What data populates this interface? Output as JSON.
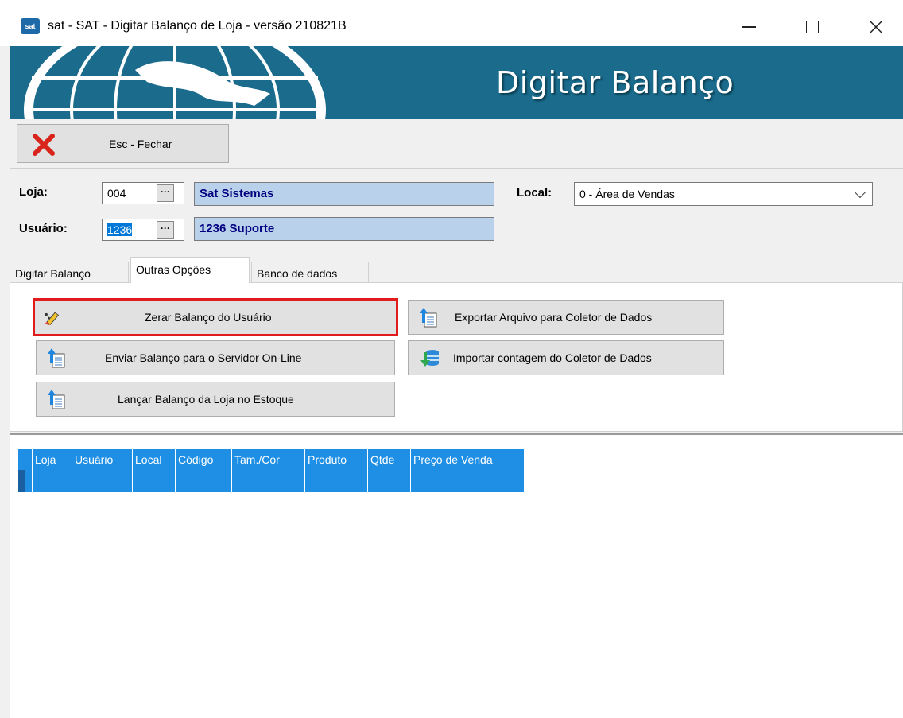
{
  "window": {
    "title": "sat - SAT - Digitar Balanço de Loja - versão 210821B",
    "icon_label": "sat"
  },
  "banner": {
    "title": "Digitar Balanço"
  },
  "toolbar": {
    "close_label": "Esc - Fechar"
  },
  "form": {
    "loja_label": "Loja:",
    "loja_code": "004",
    "loja_name": "Sat Sistemas",
    "usuario_label": "Usuário:",
    "usuario_code": "1236",
    "usuario_name": "1236 Suporte",
    "local_label": "Local:",
    "local_value": "0 - Área de Vendas",
    "dots": "···"
  },
  "tabs": [
    {
      "label": "Digitar Balanço",
      "active": false
    },
    {
      "label": "Outras Opções",
      "active": true
    },
    {
      "label": "Banco de dados",
      "active": false
    }
  ],
  "actions": {
    "zerar": "Zerar Balanço do Usuário",
    "enviar": "Enviar Balanço para o Servidor On-Line",
    "lancar": "Lançar Balanço da Loja no Estoque",
    "exportar": "Exportar Arquivo para Coletor de Dados",
    "importar": "Importar contagem do Coletor de Dados"
  },
  "grid": {
    "columns": [
      "Loja",
      "Usuário",
      "Local",
      "Código",
      "Tam./Cor",
      "Produto",
      "Qtde",
      "Preço de Venda"
    ]
  },
  "colors": {
    "banner": "#1a6b8c",
    "grid_selection": "#1e8fe4",
    "highlight_border": "#e11b1b",
    "name_box": "#b9d1ea"
  }
}
